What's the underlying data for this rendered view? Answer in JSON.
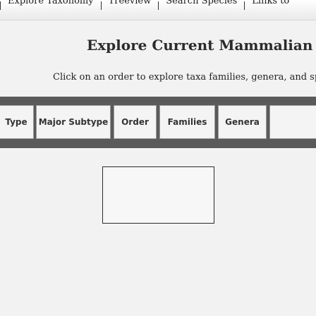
{
  "nav": {
    "items": [
      {
        "label": "Explore Taxonomy"
      },
      {
        "label": "Treeview"
      },
      {
        "label": "Search Species"
      },
      {
        "label": "Links to"
      }
    ]
  },
  "header": {
    "title": "Explore Current Mammalian",
    "subtitle": "Click on an order to explore taxa families, genera, and species"
  },
  "tabs": [
    {
      "label": "Type"
    },
    {
      "label": "Major Subtype"
    },
    {
      "label": "Order"
    },
    {
      "label": "Families"
    },
    {
      "label": "Genera"
    }
  ]
}
